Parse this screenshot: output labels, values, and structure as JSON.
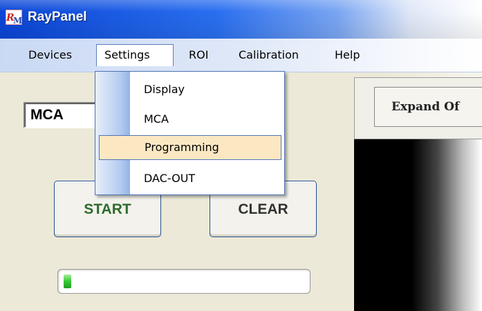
{
  "window": {
    "title": "RayPanel",
    "icon": "raypanel-logo-icon"
  },
  "menubar": {
    "items": [
      "Devices",
      "Settings",
      "ROI",
      "Calibration",
      "Help"
    ],
    "active": "Settings"
  },
  "settings_menu": {
    "items": [
      "Display",
      "MCA",
      "Programming",
      "DAC-OUT"
    ],
    "highlighted": "Programming"
  },
  "main": {
    "mode_value": "MCA",
    "start_label": "START",
    "clear_label": "CLEAR",
    "progress_fraction": 0.03
  },
  "right_panel": {
    "expand_label": "Expand Of"
  },
  "colors": {
    "title_bar": "#0a45d6",
    "start_text": "#2f6b2f",
    "menu_highlight": "#fbe8c3",
    "progress": "#37c833"
  }
}
